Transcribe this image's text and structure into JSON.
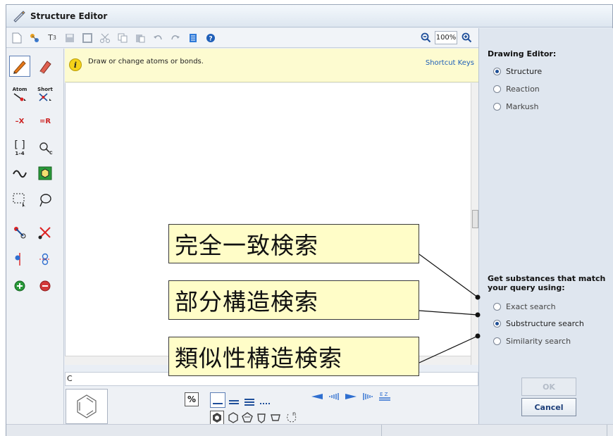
{
  "window": {
    "title": "Structure Editor"
  },
  "toolbar": {
    "icons": [
      "new-doc-icon",
      "import-icon",
      "text-icon",
      "save-icon",
      "template-icon",
      "cut-icon",
      "copy-icon",
      "paste-icon",
      "undo-icon",
      "redo-icon",
      "clean-icon",
      "help-icon"
    ],
    "zoom_value": "100%"
  },
  "left_tools": {
    "atom_label": "Atom",
    "short_label": "Short",
    "minus_x": "–X",
    "eq_r": "=R",
    "bracket_label": "1–4"
  },
  "hint": {
    "text": "Draw or change atoms or bonds.",
    "shortcut_link": "Shortcut Keys"
  },
  "formula_field": "C",
  "bottom_tools": {
    "charge_label": "%"
  },
  "right_panel": {
    "drawing_title": "Drawing Editor:",
    "drawing_modes": [
      {
        "label": "Structure",
        "selected": true
      },
      {
        "label": "Reaction",
        "selected": false
      },
      {
        "label": "Markush",
        "selected": false
      }
    ],
    "search_title_line1": "Get substances that match",
    "search_title_line2": "your query using:",
    "search_modes": [
      {
        "label": "Exact search",
        "selected": false
      },
      {
        "label": "Substructure search",
        "selected": true
      },
      {
        "label": "Similarity search",
        "selected": false
      }
    ],
    "ok_label": "OK",
    "cancel_label": "Cancel"
  },
  "callouts": {
    "exact": "完全一致検索",
    "substructure": "部分構造検索",
    "similarity": "類似性構造検索"
  },
  "colors": {
    "callout_fill": "#fffdc8",
    "hint_fill": "#fdfbd0",
    "accent": "#1e4f96"
  }
}
